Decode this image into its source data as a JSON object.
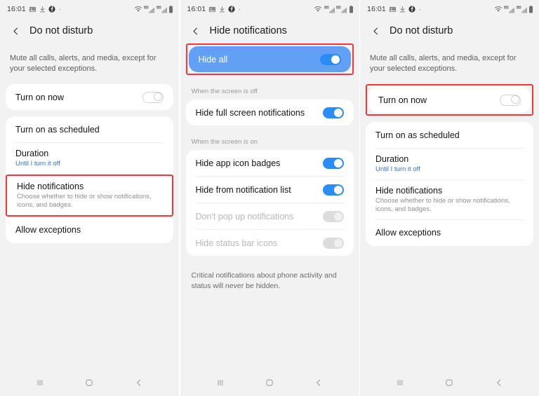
{
  "status_bar": {
    "time": "16:01",
    "left_icons": [
      "image-icon",
      "download-icon",
      "facebook-icon",
      "dot-icon"
    ],
    "right_icons": [
      "wifi-icon",
      "signal-sim1-icon",
      "signal-sim2-icon",
      "battery-icon"
    ]
  },
  "nav_bar": {
    "recents_label": "recents-icon",
    "home_label": "home-icon",
    "back_label": "back-icon"
  },
  "colors": {
    "accent_blue": "#2c8cf5",
    "selected_row_blue": "#61a0f5",
    "highlight_red": "#f8353a",
    "link_blue": "#2f6fd0",
    "page_bg": "#f2f2f2",
    "card_bg": "#ffffff"
  },
  "panels": [
    {
      "id": "dnd-initial",
      "header": {
        "title": "Do not disturb",
        "back_icon": "chevron-left-icon"
      },
      "intro": "Mute all calls, alerts, and media, except for your selected exceptions.",
      "rows": [
        {
          "title": "Turn on now",
          "toggle": "off"
        }
      ],
      "group": [
        {
          "title": "Turn on as scheduled"
        },
        {
          "title": "Duration",
          "sub": "Until I turn it off",
          "sub_style": "link"
        },
        {
          "title": "Hide notifications",
          "sub": "Choose whether to hide or show notifications, icons, and badges.",
          "highlight": true
        },
        {
          "title": "Allow exceptions"
        }
      ]
    },
    {
      "id": "hide-notifications",
      "header": {
        "title": "Hide notifications",
        "back_icon": "chevron-left-icon"
      },
      "hide_all": {
        "title": "Hide all",
        "toggle": "on",
        "highlight": true
      },
      "section_off_label": "When the screen is off",
      "section_off_rows": [
        {
          "title": "Hide full screen notifications",
          "toggle": "on"
        }
      ],
      "section_on_label": "When the screen is on",
      "section_on_rows": [
        {
          "title": "Hide app icon badges",
          "toggle": "on"
        },
        {
          "title": "Hide from notification list",
          "toggle": "on"
        },
        {
          "title": "Don't pop up notifications",
          "toggle": "disabled",
          "dim": true
        },
        {
          "title": "Hide status bar icons",
          "toggle": "disabled",
          "dim": true
        }
      ],
      "footnote": "Critical notifications about phone activity and status will never be hidden."
    },
    {
      "id": "dnd-result",
      "header": {
        "title": "Do not disturb",
        "back_icon": "chevron-left-icon"
      },
      "intro": "Mute all calls, alerts, and media, except for your selected exceptions.",
      "rows": [
        {
          "title": "Turn on now",
          "toggle": "off",
          "highlight": true
        }
      ],
      "group": [
        {
          "title": "Turn on as scheduled"
        },
        {
          "title": "Duration",
          "sub": "Until I turn it off",
          "sub_style": "link"
        },
        {
          "title": "Hide notifications",
          "sub": "Choose whether to hide or show notifications, icons, and badges."
        },
        {
          "title": "Allow exceptions"
        }
      ]
    }
  ]
}
